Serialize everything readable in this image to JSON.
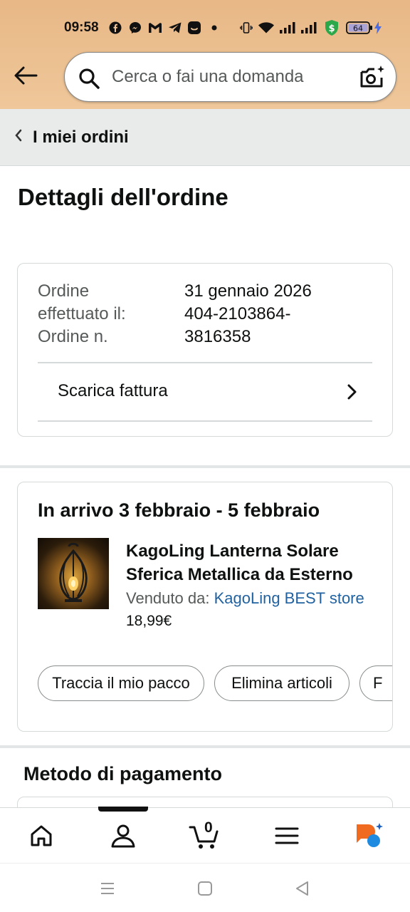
{
  "status_bar": {
    "time": "09:58",
    "battery": "64",
    "icons": [
      "facebook-icon",
      "messenger-icon",
      "gmail-icon",
      "telegram-icon",
      "app-icon",
      "dot-icon",
      "vibrate-icon",
      "wifi-icon",
      "signal-icon",
      "signal-icon",
      "dollar-shield-icon",
      "battery-icon",
      "charging-icon"
    ]
  },
  "header": {
    "search_placeholder": "Cerca o fai una domanda",
    "brand_color": "#efc79a"
  },
  "breadcrumb": {
    "label": "I miei ordini"
  },
  "page": {
    "title": "Dettagli dell'ordine"
  },
  "order_info": {
    "date_label": "Ordine effettuato il:",
    "date_value": "31 gennaio 2026",
    "number_label": "Ordine n.",
    "number_value": "404-2103864-3816358",
    "invoice_label": "Scarica fattura"
  },
  "shipment": {
    "arrival": "In arrivo 3 febbraio - 5 febbraio",
    "product_name": "KagoLing Lanterna Solare Sferica Metallica da Esterno",
    "seller_label": "Venduto da:",
    "seller_name": "KagoLing BEST store",
    "price": "18,99€",
    "actions": [
      "Traccia il mio pacco",
      "Elimina articoli",
      "F"
    ]
  },
  "payment": {
    "title": "Metodo di pagamento"
  },
  "bottom_nav": {
    "items": [
      "home-icon",
      "account-icon",
      "cart-icon",
      "menu-icon",
      "rufus-ai-icon"
    ],
    "cart_count": "0"
  },
  "colors": {
    "link": "#2162a1",
    "text": "#0f1111",
    "muted": "#565959"
  }
}
